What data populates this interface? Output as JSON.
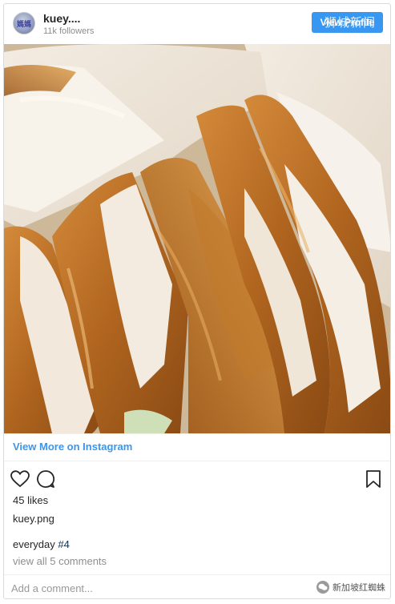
{
  "header": {
    "avatar_text": "媽媽",
    "username": "kuey....",
    "followers": "11k followers",
    "view_profile_label": "View Profile",
    "watermark_top": "狮城新闻"
  },
  "photo": {
    "description_icon": "photo-image"
  },
  "links": {
    "view_more": "View More on Instagram"
  },
  "actions": {
    "like_icon": "heart-icon",
    "comment_icon": "comment-icon",
    "save_icon": "bookmark-icon"
  },
  "post": {
    "likes": "45 likes",
    "filename": "kuey.png",
    "caption_text": "everyday ",
    "caption_hashtag": "#4",
    "view_comments": "view all 5 comments"
  },
  "comment": {
    "placeholder": "Add a comment..."
  },
  "watermark_bottom": "新加坡红蜘蛛",
  "colors": {
    "accent": "#3897f0",
    "text": "#262626",
    "muted": "#8e8e8e",
    "hashtag": "#003569"
  }
}
